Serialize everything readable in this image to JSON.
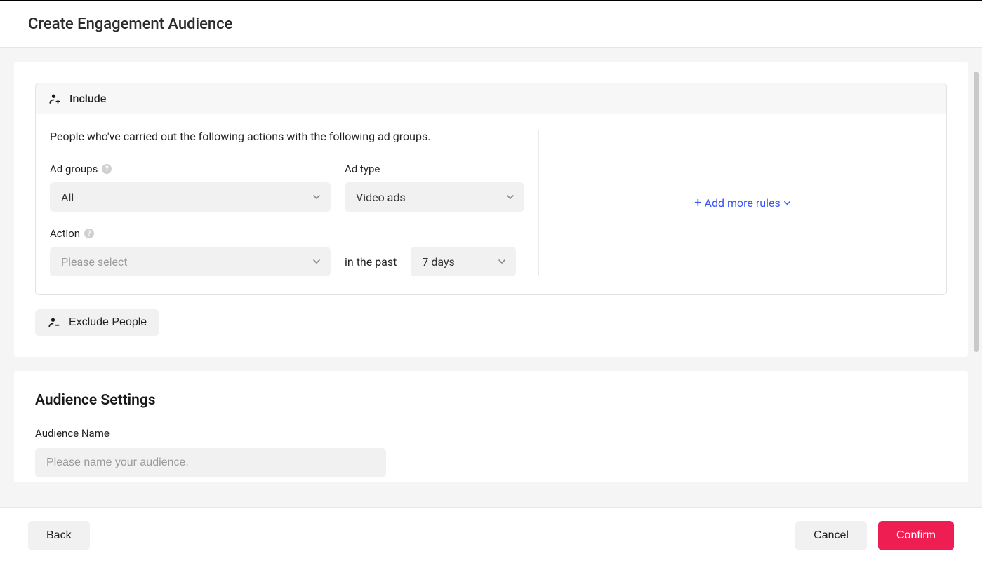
{
  "header": {
    "title": "Create Engagement Audience"
  },
  "include": {
    "label": "Include",
    "rule_description": "People who've carried out the following actions with the following ad groups.",
    "ad_groups_label": "Ad groups",
    "ad_groups_value": "All",
    "ad_type_label": "Ad type",
    "ad_type_value": "Video ads",
    "action_label": "Action",
    "action_placeholder": "Please select",
    "in_the_past_text": "in the past",
    "time_value": "7 days",
    "add_more_rules": "Add more rules"
  },
  "exclude": {
    "button_label": "Exclude People"
  },
  "audience_settings": {
    "title": "Audience Settings",
    "name_label": "Audience Name",
    "name_placeholder": "Please name your audience."
  },
  "footer": {
    "back": "Back",
    "cancel": "Cancel",
    "confirm": "Confirm"
  }
}
